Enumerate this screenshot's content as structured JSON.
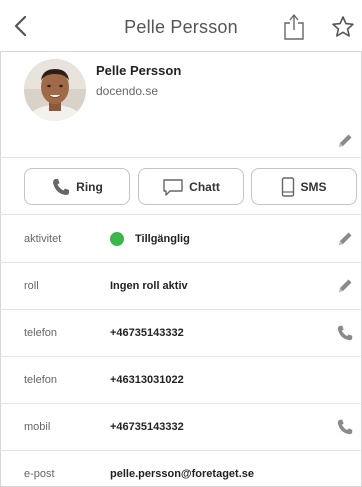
{
  "header": {
    "title": "Pelle Persson"
  },
  "profile": {
    "name": "Pelle Persson",
    "company": "docendo.se"
  },
  "actions": {
    "ring_label": "Ring",
    "chatt_label": "Chatt",
    "sms_label": "SMS"
  },
  "rows": [
    {
      "label": "aktivitet",
      "value": "Tillgänglig",
      "status_color": "#3cb54a",
      "icon": "pencil-icon"
    },
    {
      "label": "roll",
      "value": "Ingen roll aktiv",
      "icon": "pencil-icon"
    },
    {
      "label": "telefon",
      "value": "+46735143332",
      "icon": "phone-icon"
    },
    {
      "label": "telefon",
      "value": "+46313031022"
    },
    {
      "label": "mobil",
      "value": "+46735143332",
      "icon": "phone-icon"
    },
    {
      "label": "e-post",
      "value": "pelle.persson@foretaget.se"
    }
  ],
  "colors": {
    "accent": "#3cb54a",
    "icon_gray": "#8a8a8a"
  }
}
